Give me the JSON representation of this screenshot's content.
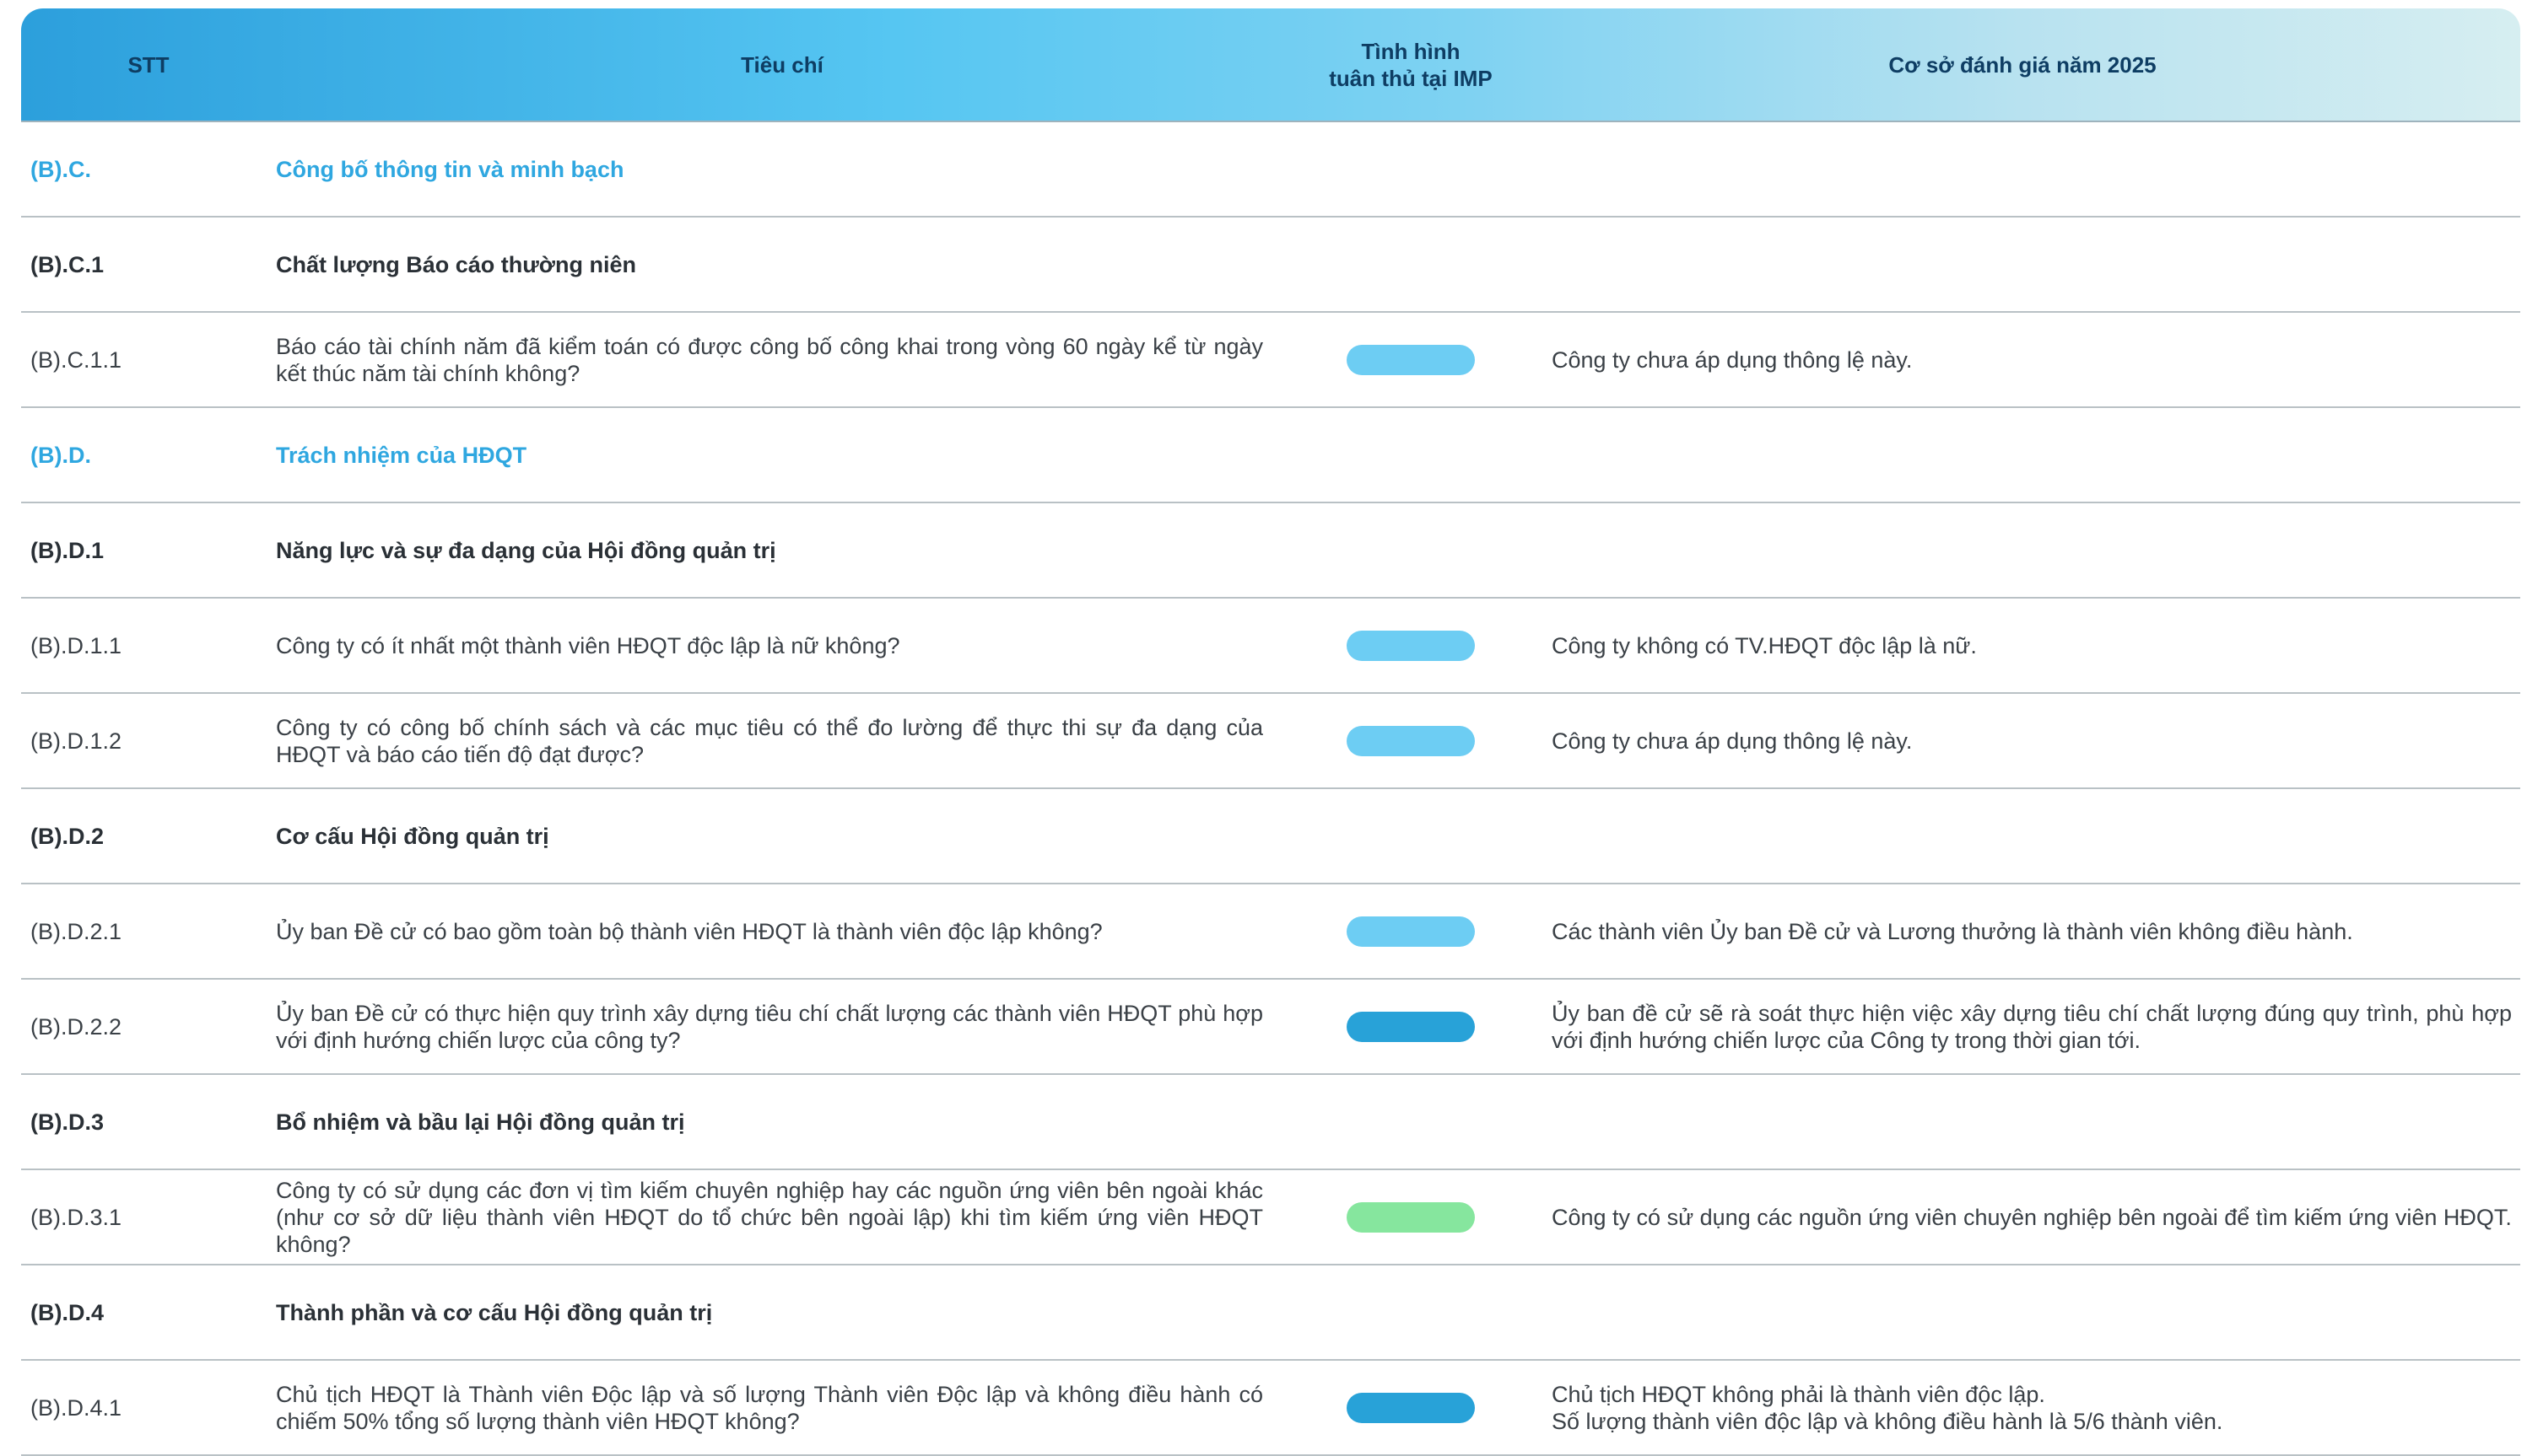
{
  "header": {
    "stt": "STT",
    "criteria": "Tiêu chí",
    "status_line1": "Tình hình",
    "status_line2": "tuân thủ tại IMP",
    "basis": "Cơ sở đánh giá năm 2025"
  },
  "status_colors": {
    "light_blue": "#6dcdf3",
    "dark_blue": "#28a2d8",
    "green": "#86e69e"
  },
  "rows": [
    {
      "type": "section",
      "code": "(B).C.",
      "label": "Công bố thông tin và minh bạch"
    },
    {
      "type": "sub",
      "code": "(B).C.1",
      "label": "Chất lượng Báo cáo thường niên"
    },
    {
      "type": "item",
      "code": "(B).C.1.1",
      "label": "Báo cáo tài chính năm đã kiểm toán có được công bố công khai trong vòng 60 ngày kể từ ngày kết thúc năm tài chính không?",
      "status": "light_blue",
      "basis": [
        "Công ty chưa áp dụng thông lệ này."
      ]
    },
    {
      "type": "section",
      "code": "(B).D.",
      "label": "Trách nhiệm của HĐQT"
    },
    {
      "type": "sub",
      "code": "(B).D.1",
      "label": "Năng lực và sự đa dạng của Hội đồng quản trị"
    },
    {
      "type": "item",
      "code": "(B).D.1.1",
      "label": "Công ty có ít nhất một thành viên HĐQT độc lập là nữ không?",
      "status": "light_blue",
      "basis": [
        "Công ty không có TV.HĐQT độc lập là nữ."
      ]
    },
    {
      "type": "item",
      "code": "(B).D.1.2",
      "label": "Công ty có công bố chính sách và các mục tiêu có thể đo lường để thực thi sự đa dạng của HĐQT và báo cáo tiến độ đạt được?",
      "status": "light_blue",
      "basis": [
        "Công ty chưa áp dụng thông lệ này."
      ]
    },
    {
      "type": "sub",
      "code": "(B).D.2",
      "label": "Cơ cấu Hội đồng quản trị"
    },
    {
      "type": "item",
      "code": "(B).D.2.1",
      "label": "Ủy ban Đề cử có bao gồm toàn bộ thành viên HĐQT là thành viên độc lập không?",
      "status": "light_blue",
      "basis": [
        "Các thành viên Ủy ban Đề cử và Lương thưởng là thành viên không điều hành."
      ]
    },
    {
      "type": "item",
      "code": "(B).D.2.2",
      "label": "Ủy ban Đề cử có thực hiện quy trình xây dựng tiêu chí chất lượng các thành viên HĐQT phù hợp với định hướng chiến lược của công ty?",
      "status": "dark_blue",
      "basis": [
        "Ủy ban đề cử sẽ rà soát thực hiện việc xây dựng tiêu chí chất lượng đúng quy trình, phù hợp với định hướng chiến lược của Công ty trong thời gian tới."
      ]
    },
    {
      "type": "sub",
      "code": "(B).D.3",
      "label": "Bổ nhiệm và bầu lại Hội đồng quản trị"
    },
    {
      "type": "item",
      "code": "(B).D.3.1",
      "label": "Công ty có sử dụng các đơn vị tìm kiếm chuyên nghiệp hay các nguồn ứng viên bên ngoài khác (như cơ sở dữ liệu thành viên HĐQT do tổ chức bên ngoài lập) khi tìm kiếm ứng viên HĐQT không?",
      "status": "green",
      "basis": [
        "Công ty có sử dụng các nguồn ứng viên chuyên nghiệp bên ngoài để tìm kiếm ứng viên HĐQT."
      ]
    },
    {
      "type": "sub",
      "code": "(B).D.4",
      "label": "Thành phần và cơ cấu Hội đồng quản trị"
    },
    {
      "type": "item",
      "code": "(B).D.4.1",
      "label": "Chủ tịch HĐQT là Thành viên Độc lập và số lượng Thành viên Độc lập và không điều hành có chiếm 50% tổng số lượng thành viên HĐQT không?",
      "status": "dark_blue",
      "basis": [
        "Chủ tịch HĐQT không phải là thành viên độc lập.",
        "Số lượng thành viên độc lập và không điều hành là 5/6 thành viên."
      ]
    }
  ]
}
